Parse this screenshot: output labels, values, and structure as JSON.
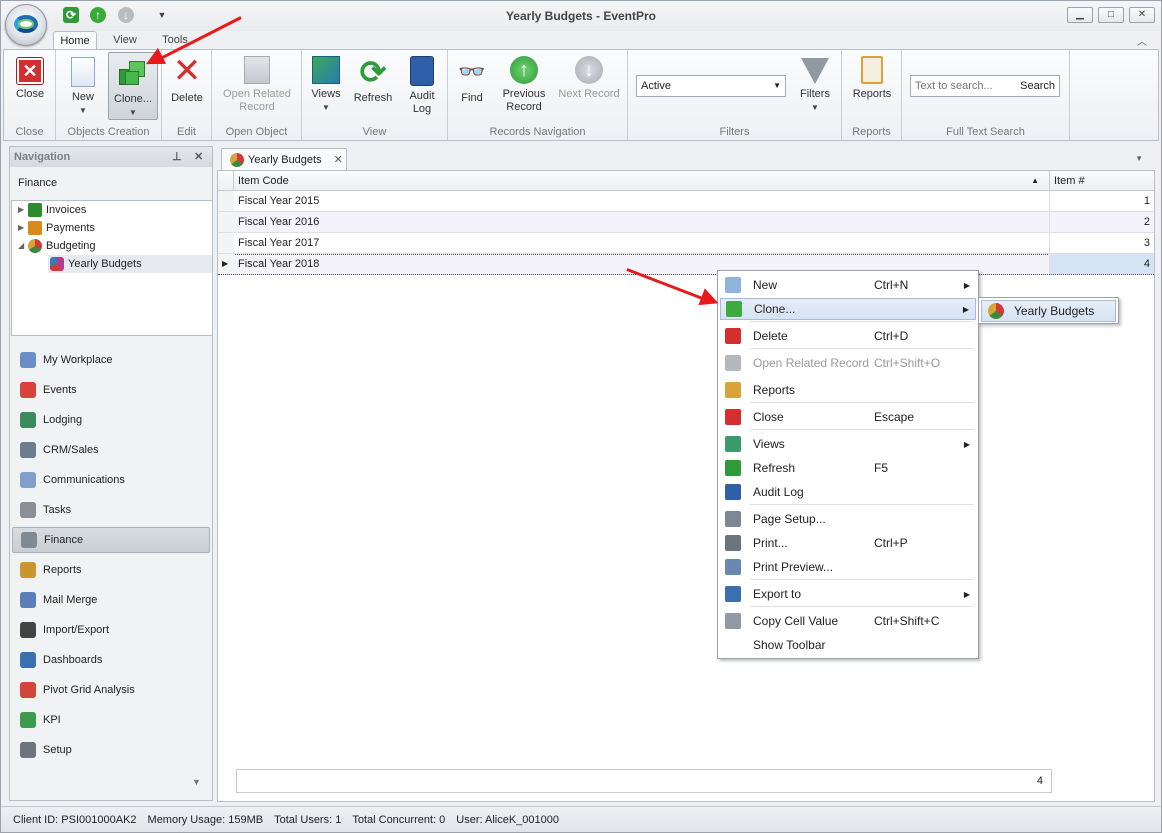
{
  "window": {
    "title": "Yearly Budgets - EventPro",
    "minimize": "▁",
    "maximize": "□",
    "close": "✕"
  },
  "ribbon_tabs": [
    {
      "label": "Home"
    },
    {
      "label": "View"
    },
    {
      "label": "Tools"
    }
  ],
  "ribbon": {
    "groups": [
      {
        "label": "Close"
      },
      {
        "label": "Objects Creation"
      },
      {
        "label": "Edit"
      },
      {
        "label": "Open Object"
      },
      {
        "label": "View"
      },
      {
        "label": "Records Navigation"
      },
      {
        "label": "Filters"
      },
      {
        "label": "Reports"
      },
      {
        "label": "Full Text Search"
      }
    ],
    "buttons": {
      "close": "Close",
      "new": "New",
      "clone": "Clone...",
      "delete": "Delete",
      "open_related_1": "Open Related",
      "open_related_2": "Record",
      "views": "Views",
      "refresh": "Refresh",
      "audit_1": "Audit",
      "audit_2": "Log",
      "find": "Find",
      "prev_1": "Previous",
      "prev_2": "Record",
      "next": "Next Record",
      "filters": "Filters",
      "reports": "Reports",
      "search": "Search"
    },
    "filter_value": "Active",
    "search_placeholder": "Text to search..."
  },
  "navigation": {
    "title": "Navigation",
    "section": "Finance",
    "tree": [
      {
        "label": "Invoices",
        "color": "#2e8b2e"
      },
      {
        "label": "Payments",
        "color": "#d98a1c"
      },
      {
        "label": "Budgeting",
        "color": "#c43d3d"
      },
      {
        "label": "Yearly Budgets",
        "color": "#b83a8e"
      }
    ],
    "items": [
      {
        "label": "My Workplace",
        "color": "#6a8fc7"
      },
      {
        "label": "Events",
        "color": "#d9423a"
      },
      {
        "label": "Lodging",
        "color": "#3c8b5a"
      },
      {
        "label": "CRM/Sales",
        "color": "#6d7c8f"
      },
      {
        "label": "Communications",
        "color": "#7fa1c9"
      },
      {
        "label": "Tasks",
        "color": "#8a8f95"
      },
      {
        "label": "Finance",
        "color": "#7f8a95"
      },
      {
        "label": "Reports",
        "color": "#c9952e"
      },
      {
        "label": "Mail Merge",
        "color": "#5a7db8"
      },
      {
        "label": "Import/Export",
        "color": "#444444"
      },
      {
        "label": "Dashboards",
        "color": "#3a6fb0"
      },
      {
        "label": "Pivot Grid Analysis",
        "color": "#d2463a"
      },
      {
        "label": "KPI",
        "color": "#3e9a4c"
      },
      {
        "label": "Setup",
        "color": "#6b7480"
      }
    ]
  },
  "doc_tab": {
    "label": "Yearly Budgets"
  },
  "grid": {
    "columns": [
      "Item Code",
      "Item #"
    ],
    "rows": [
      {
        "code": "Fiscal Year 2015",
        "num": "1"
      },
      {
        "code": "Fiscal Year 2016",
        "num": "2"
      },
      {
        "code": "Fiscal Year 2017",
        "num": "3"
      },
      {
        "code": "Fiscal Year 2018",
        "num": "4"
      }
    ],
    "footer_count": "4"
  },
  "context_menu": {
    "items": [
      {
        "label": "New",
        "shortcut": "Ctrl+N",
        "submenu": true,
        "disabled": false,
        "icon": "new-doc-icon",
        "color": "#8fb3dd"
      },
      {
        "label": "Clone...",
        "shortcut": "",
        "submenu": true,
        "disabled": false,
        "icon": "clone-icon",
        "color": "#3eaa3e"
      },
      {
        "label": "Delete",
        "shortcut": "Ctrl+D",
        "submenu": false,
        "disabled": false,
        "icon": "delete-icon",
        "color": "#d32f2f"
      },
      {
        "label": "Open Related Record",
        "shortcut": "Ctrl+Shift+O",
        "submenu": false,
        "disabled": true,
        "icon": "open-related-icon",
        "color": "#b5b9be"
      },
      {
        "label": "Reports",
        "shortcut": "",
        "submenu": false,
        "disabled": false,
        "icon": "reports-icon",
        "color": "#d9a33a"
      },
      {
        "label": "Close",
        "shortcut": "Escape",
        "submenu": false,
        "disabled": false,
        "icon": "close-icon",
        "color": "#d32f2f"
      },
      {
        "label": "Views",
        "shortcut": "",
        "submenu": true,
        "disabled": false,
        "icon": "views-icon",
        "color": "#3a9a6a"
      },
      {
        "label": "Refresh",
        "shortcut": "F5",
        "submenu": false,
        "disabled": false,
        "icon": "refresh-icon",
        "color": "#2e9a3a"
      },
      {
        "label": "Audit Log",
        "shortcut": "",
        "submenu": false,
        "disabled": false,
        "icon": "audit-log-icon",
        "color": "#2f5fa8"
      },
      {
        "label": "Page Setup...",
        "shortcut": "",
        "submenu": false,
        "disabled": false,
        "icon": "page-setup-icon",
        "color": "#7c8894"
      },
      {
        "label": "Print...",
        "shortcut": "Ctrl+P",
        "submenu": false,
        "disabled": false,
        "icon": "print-icon",
        "color": "#6b7480"
      },
      {
        "label": "Print Preview...",
        "shortcut": "",
        "submenu": false,
        "disabled": false,
        "icon": "print-preview-icon",
        "color": "#6b88b0"
      },
      {
        "label": "Export to",
        "shortcut": "",
        "submenu": true,
        "disabled": false,
        "icon": "export-icon",
        "color": "#3d6fb0"
      },
      {
        "label": "Copy Cell Value",
        "shortcut": "Ctrl+Shift+C",
        "submenu": false,
        "disabled": false,
        "icon": "copy-icon",
        "color": "#8f9aa5"
      },
      {
        "label": "Show Toolbar",
        "shortcut": "",
        "submenu": false,
        "disabled": false,
        "icon": "",
        "color": ""
      }
    ],
    "submenu_label": "Yearly Budgets"
  },
  "status": {
    "client": "Client ID: PSI001000AK2",
    "memory": "Memory Usage: 159MB",
    "users": "Total Users: 1",
    "concurrent": "Total Concurrent: 0",
    "user": "User: AliceK_001000"
  },
  "colors": {
    "annotation_arrow": "#e8191b",
    "accent": "#1f6fb8"
  }
}
